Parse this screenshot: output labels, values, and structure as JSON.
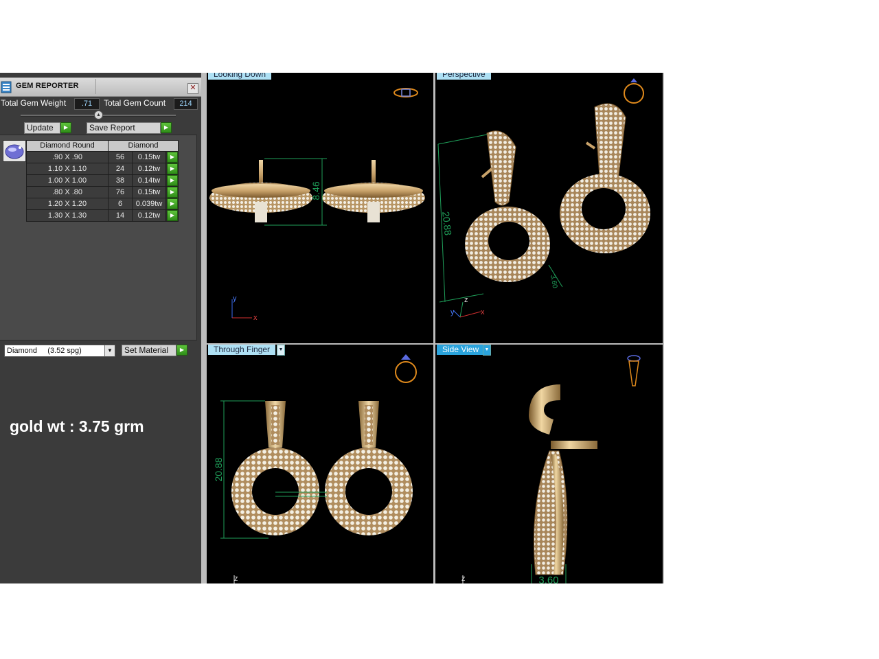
{
  "gem_reporter": {
    "title": "GEM REPORTER",
    "close": "✕",
    "total_weight_label": "Total Gem Weight",
    "total_weight_value": ".71",
    "total_count_label": "Total Gem Count",
    "total_count_value": "214",
    "update_label": "Update",
    "save_report_label": "Save Report",
    "table": {
      "headers": [
        "Diamond Round",
        "Diamond"
      ],
      "rows": [
        {
          "size": ".90 X .90",
          "count": "56",
          "weight": "0.15tw"
        },
        {
          "size": "1.10 X 1.10",
          "count": "24",
          "weight": "0.12tw"
        },
        {
          "size": "1.00 X 1.00",
          "count": "38",
          "weight": "0.14tw"
        },
        {
          "size": ".80 X .80",
          "count": "76",
          "weight": "0.15tw"
        },
        {
          "size": "1.20 X 1.20",
          "count": "6",
          "weight": "0.039tw"
        },
        {
          "size": "1.30 X 1.30",
          "count": "14",
          "weight": "0.12tw"
        }
      ]
    },
    "material_value": "Diamond     (3.52 spg)",
    "set_material_label": "Set Material"
  },
  "annotation": {
    "gold_wt": "gold wt : 3.75 grm"
  },
  "viewports": {
    "top_left": {
      "label": "Looking Down",
      "dimension": "8.46",
      "axis_y": "y",
      "axis_x": "x"
    },
    "top_right": {
      "label": "Perspective",
      "dim_height": "20.88",
      "dim_small": "3.60",
      "axis_z": "z",
      "axis_y": "y",
      "axis_x": "x"
    },
    "bottom_left": {
      "label": "Through Finger",
      "dimension": "20.88",
      "axis_z": "z"
    },
    "bottom_right": {
      "label": "Side View",
      "dimension": "3.60",
      "axis_z": "z"
    }
  },
  "colors": {
    "gold": "#c8a26a",
    "dim_line": "#1fa05a",
    "viewport_bg": "#000000",
    "panel_bg": "#3b3b3b",
    "active_tab": "#2aa3dc"
  }
}
